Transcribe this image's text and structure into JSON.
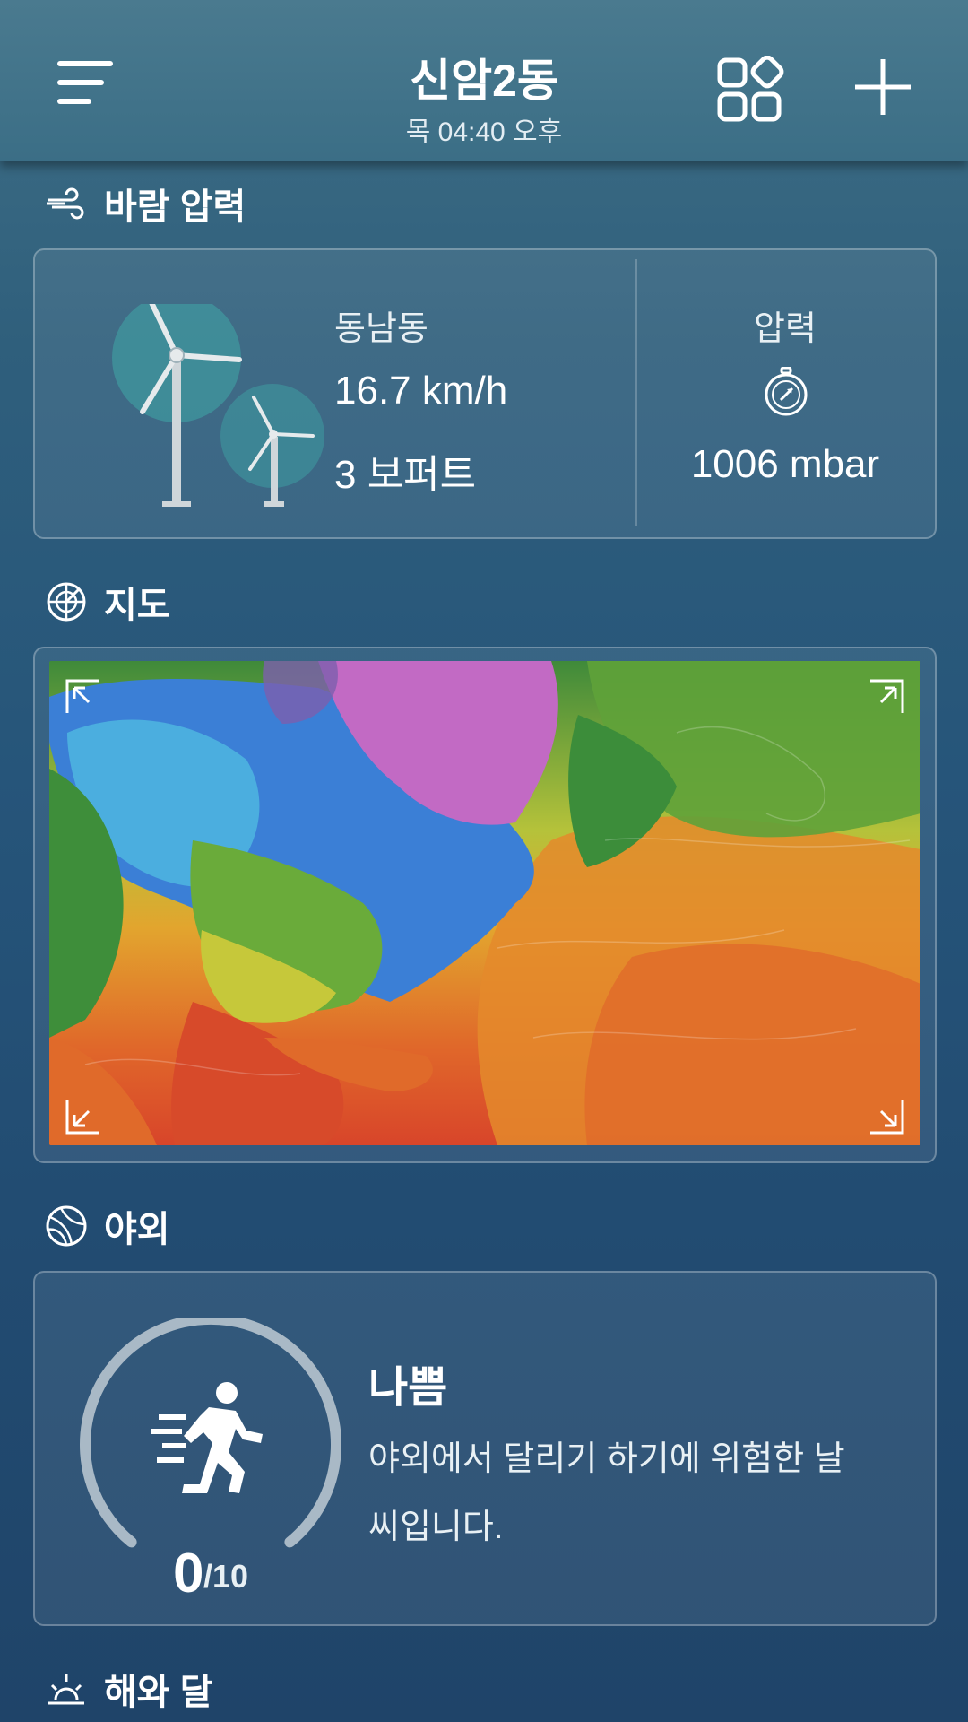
{
  "header": {
    "title": "신암2동",
    "subtitle": "목 04:40 오후"
  },
  "wind_section": {
    "heading": "바람 압력",
    "direction": "동남동",
    "speed": "16.7 km/h",
    "beaufort": "3 보퍼트",
    "pressure_label": "압력",
    "pressure_value": "1006 mbar"
  },
  "map_section": {
    "heading": "지도"
  },
  "outdoor_section": {
    "heading": "야외",
    "score": "0",
    "score_max": "/10",
    "score_fraction": 0,
    "level": "나쁨",
    "description": "야외에서 달리기 하기에 위험한 날씨입니다."
  },
  "sun_moon_section": {
    "heading": "해와 달"
  },
  "icons": [
    "menu-icon",
    "widgets-icon",
    "add-icon",
    "wind-icon",
    "radar-icon",
    "ball-icon",
    "sunrise-icon",
    "compass-icon",
    "runner-icon",
    "wind-turbine-icon"
  ]
}
